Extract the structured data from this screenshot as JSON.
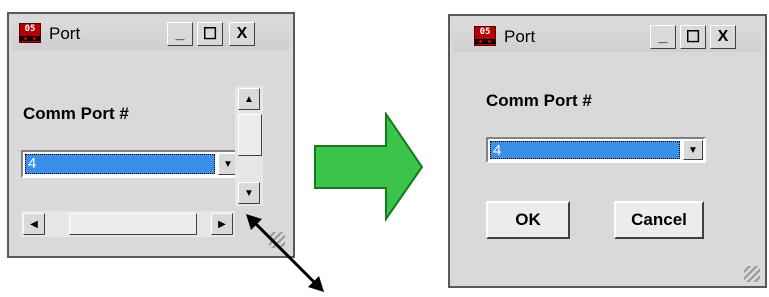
{
  "windows": {
    "before": {
      "title": "Port",
      "label": "Comm Port #",
      "combo_value": "4"
    },
    "after": {
      "title": "Port",
      "label": "Comm Port #",
      "combo_value": "4",
      "ok_label": "OK",
      "cancel_label": "Cancel"
    }
  },
  "icons": {
    "app": "05",
    "minimize": "_",
    "maximize": "☐",
    "close": "X",
    "scroll_up": "▲",
    "scroll_down": "▼",
    "scroll_left": "◀",
    "scroll_right": "▶",
    "dropdown": "▼"
  },
  "colors": {
    "arrow_fill": "#3cc34a",
    "arrow_stroke": "#127a1f",
    "selection": "#3b8fe8",
    "icon_red": "#b40000"
  }
}
